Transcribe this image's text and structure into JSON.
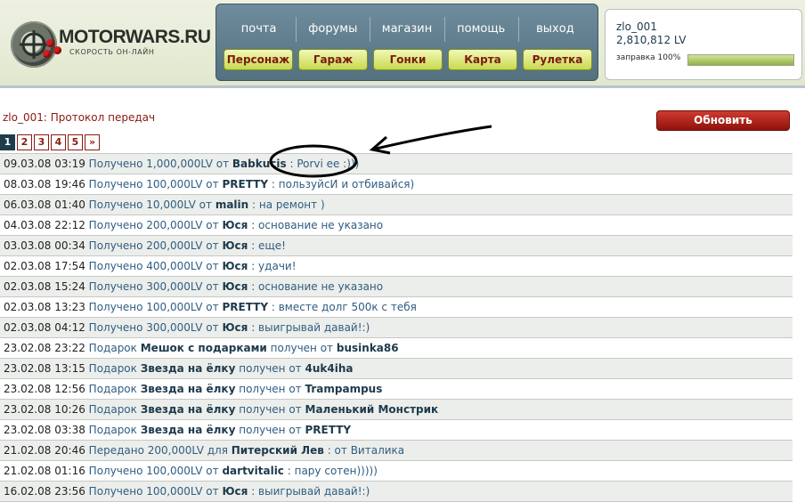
{
  "brand": {
    "name": "MOTORWARS.RU",
    "tagline": "СКОРОСТЬ ОН-ЛАЙН"
  },
  "top_nav": [
    "почта",
    "форумы",
    "магазин",
    "помощь",
    "выход"
  ],
  "game_nav": [
    "Персонаж",
    "Гараж",
    "Гонки",
    "Карта",
    "Рулетка"
  ],
  "user": {
    "name": "zlo_001",
    "money": "2,810,812 LV",
    "fuel_label": "заправка 100%",
    "fuel_level": 1.0
  },
  "page": {
    "title": "zlo_001: Протокол передач",
    "refresh_label": "Обновить"
  },
  "pagination": {
    "pages": [
      "1",
      "2",
      "3",
      "4",
      "5"
    ],
    "next": "»",
    "active": "1"
  },
  "log": [
    {
      "date": "09.03.08 03:19",
      "pre": "Получено 1,000,000LV от",
      "nick": "Babkucis",
      "mid": "",
      "nick2": "",
      "msg": ": Porvi ee :)))"
    },
    {
      "date": "08.03.08 19:46",
      "pre": "Получено 100,000LV от",
      "nick": "PRETTY",
      "mid": "",
      "nick2": "",
      "msg": ": пользуйсИ и отбивайся)"
    },
    {
      "date": "06.03.08 01:40",
      "pre": "Получено 10,000LV от",
      "nick": "malin",
      "mid": "",
      "nick2": "",
      "msg": ": на ремонт )"
    },
    {
      "date": "04.03.08 22:12",
      "pre": "Получено 200,000LV от",
      "nick": "Юся",
      "mid": "",
      "nick2": "",
      "msg": ": основание не указано"
    },
    {
      "date": "03.03.08 00:34",
      "pre": "Получено 200,000LV от",
      "nick": "Юся",
      "mid": "",
      "nick2": "",
      "msg": ": еще!"
    },
    {
      "date": "02.03.08 17:54",
      "pre": "Получено 400,000LV от",
      "nick": "Юся",
      "mid": "",
      "nick2": "",
      "msg": ": удачи!"
    },
    {
      "date": "02.03.08 15:24",
      "pre": "Получено 300,000LV от",
      "nick": "Юся",
      "mid": "",
      "nick2": "",
      "msg": ": основание не указано"
    },
    {
      "date": "02.03.08 13:23",
      "pre": "Получено 100,000LV от",
      "nick": "PRETTY",
      "mid": "",
      "nick2": "",
      "msg": ": вместе долг 500к с тебя"
    },
    {
      "date": "02.03.08 04:12",
      "pre": "Получено 300,000LV от",
      "nick": "Юся",
      "mid": "",
      "nick2": "",
      "msg": ": выигрывай давай!:)"
    },
    {
      "date": "23.02.08 23:22",
      "pre": "Подарок",
      "nick": "Мешок с подарками",
      "mid": "получен от",
      "nick2": "businka86",
      "msg": ""
    },
    {
      "date": "23.02.08 13:15",
      "pre": "Подарок",
      "nick": "Звезда на ёлку",
      "mid": "получен от",
      "nick2": "4uk4iha",
      "msg": ""
    },
    {
      "date": "23.02.08 12:56",
      "pre": "Подарок",
      "nick": "Звезда на ёлку",
      "mid": "получен от",
      "nick2": "Trampampus",
      "msg": ""
    },
    {
      "date": "23.02.08 10:26",
      "pre": "Подарок",
      "nick": "Звезда на ёлку",
      "mid": "получен от",
      "nick2": "Маленький Монстрик",
      "msg": ""
    },
    {
      "date": "23.02.08 03:38",
      "pre": "Подарок",
      "nick": "Звезда на ёлку",
      "mid": "получен от",
      "nick2": "PRETTY",
      "msg": ""
    },
    {
      "date": "21.02.08 20:46",
      "pre": "Передано 200,000LV для",
      "nick": "Питерский Лев",
      "mid": "",
      "nick2": "",
      "msg": ": от Виталика"
    },
    {
      "date": "21.02.08 01:16",
      "pre": "Получено 100,000LV от",
      "nick": "dartvitalic",
      "mid": "",
      "nick2": "",
      "msg": ": пару сотен)))))"
    },
    {
      "date": "16.02.08 23:56",
      "pre": "Получено 100,000LV от",
      "nick": "Юся",
      "mid": "",
      "nick2": "",
      "msg": ": выигрывай давай!:)"
    }
  ],
  "colors": {
    "nav_panel": "#5f7d8c",
    "accent_red": "#8c1a12",
    "button_green": "#c9d94e",
    "link_blue": "#2f5d82"
  }
}
